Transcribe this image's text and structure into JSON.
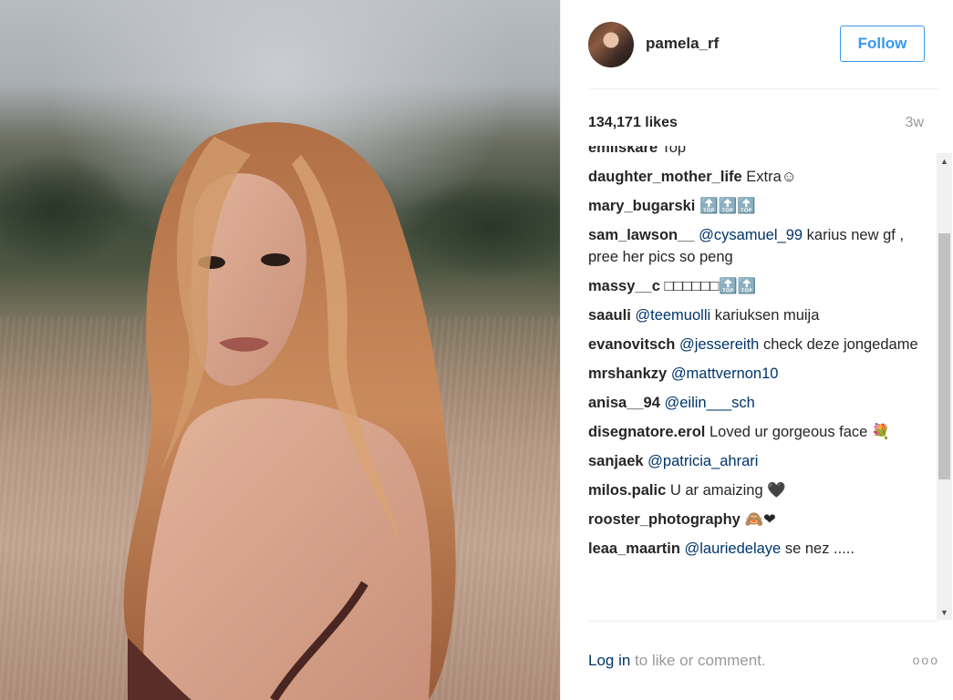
{
  "post": {
    "username": "pamela_rf",
    "follow_label": "Follow",
    "likes": "134,171 likes",
    "age": "3w"
  },
  "comments": [
    {
      "user": "emiiskare",
      "text": "Top"
    },
    {
      "user": "daughter_mother_life",
      "text": "Extra☺"
    },
    {
      "user": "mary_bugarski",
      "text": "🔝🔝🔝"
    },
    {
      "user": "sam_lawson__",
      "mention": "@cysamuel_99",
      "text": "karius new gf , pree her pics so peng"
    },
    {
      "user": "massy__c",
      "text": "□□□□□□🔝🔝"
    },
    {
      "user": "saauli",
      "mention": "@teemuolli",
      "text": "kariuksen muija"
    },
    {
      "user": "evanovitsch",
      "mention": "@jessereith",
      "text": "check deze jongedame"
    },
    {
      "user": "mrshankzy",
      "mention": "@mattvernon10",
      "text": ""
    },
    {
      "user": "anisa__94",
      "mention": "@eilin___sch",
      "text": ""
    },
    {
      "user": "disegnatore.erol",
      "text": "Loved ur gorgeous face 💐"
    },
    {
      "user": "sanjaek",
      "mention": "@patricia_ahrari",
      "text": ""
    },
    {
      "user": "milos.palic",
      "text": "U ar amaizing 🖤"
    },
    {
      "user": "rooster_photography",
      "text": "🙈❤"
    },
    {
      "user": "leaa_maartin",
      "mention": "@lauriedelaye",
      "text": "se nez ....."
    }
  ],
  "footer": {
    "login_link": "Log in",
    "login_text": " to like or comment.",
    "more": "ooo"
  },
  "colors": {
    "accent": "#3897f0",
    "link": "#003569",
    "muted": "#999999"
  }
}
